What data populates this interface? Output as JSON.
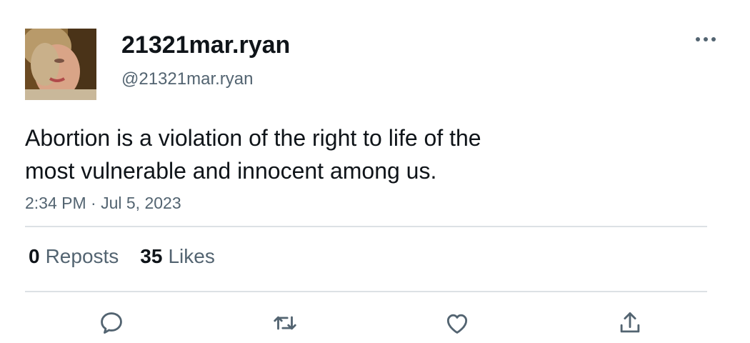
{
  "tweet": {
    "display_name": "21321mar.ryan",
    "handle": "@21321mar.ryan",
    "text_line1": "Abortion is a violation of the right to life of the",
    "text_line2": "most vulnerable and innocent among us.",
    "timestamp": "2:34 PM · Jul 5, 2023",
    "reposts_count": "0",
    "reposts_label": "Reposts",
    "likes_count": "35",
    "likes_label": "Likes"
  },
  "icons": {
    "more": "more-horizontal-icon",
    "reply": "reply-icon",
    "repost": "repost-icon",
    "like": "heart-icon",
    "share": "share-icon"
  },
  "colors": {
    "text_primary": "#0f1419",
    "text_secondary": "#536471",
    "divider": "#dce1e5"
  }
}
